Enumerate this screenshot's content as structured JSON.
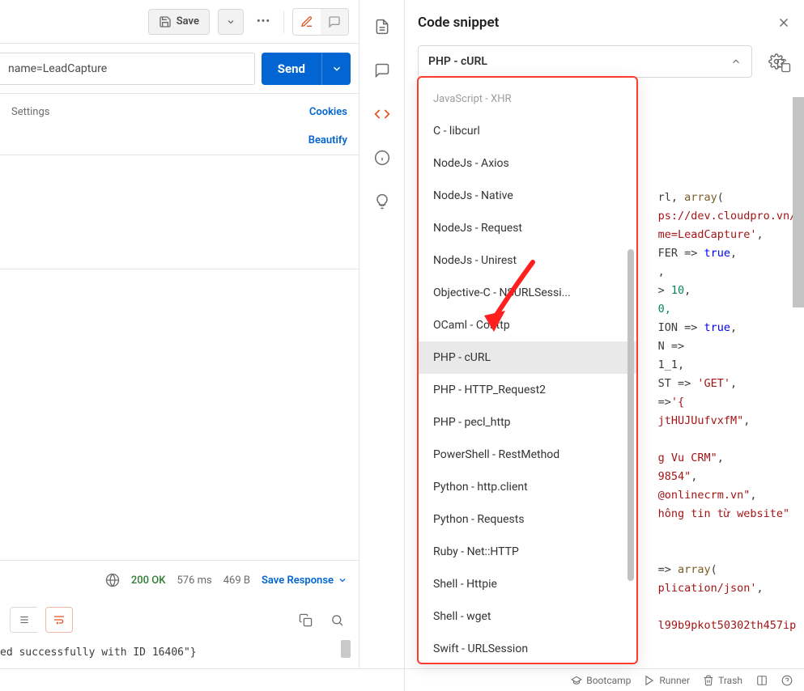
{
  "toolbar": {
    "save_label": "Save"
  },
  "url": {
    "value": "name=LeadCapture"
  },
  "send_label": "Send",
  "tabs": {
    "settings_label": "Settings",
    "cookies_label": "Cookies",
    "beautify_label": "Beautify"
  },
  "response": {
    "status": "200 OK",
    "time": "576 ms",
    "size": "469 B",
    "save_label": "Save Response",
    "body": "ed successfully with ID 16406\"}"
  },
  "snippet": {
    "title": "Code snippet",
    "selected": "PHP - cURL",
    "options": [
      "JavaScript - XHR",
      "C - libcurl",
      "NodeJs - Axios",
      "NodeJs - Native",
      "NodeJs - Request",
      "NodeJs - Unirest",
      "Objective-C - NSURLSessi...",
      "OCaml - Cohttp",
      "PHP - cURL",
      "PHP - HTTP_Request2",
      "PHP - pecl_http",
      "PowerShell - RestMethod",
      "Python - http.client",
      "Python - Requests",
      "Ruby - Net::HTTP",
      "Shell - Httpie",
      "Shell - wget",
      "Swift - URLSession"
    ]
  },
  "code": {
    "l1a": "rl, ",
    "l1b": "array",
    "l1c": "(",
    "l2": "ps://dev.cloudpro.vn/",
    "l3": "me=LeadCapture'",
    "l4a": "FER => ",
    "l4b": "true",
    "l5": ",",
    "l6a": "> ",
    "l6b": "10",
    "l7": "0,",
    "l8a": "ION => ",
    "l8b": "true",
    "l9": "N =>",
    "l10": "1_1,",
    "l11a": "ST => ",
    "l11b": "'GET'",
    "l12a": "=>",
    "l12b": "'{",
    "l13": "jtHUJUufvxfM\"",
    "l14": "",
    "l15": "g Vu CRM\"",
    "l16": "9854\"",
    "l17": "@onlinecrm.vn\"",
    "l18": "hông tin từ website\"",
    "l19": "",
    "l20a": "=> ",
    "l20b": "array",
    "l20c": "(",
    "l21": "plication/json'",
    "l22": "",
    "l23": "l99b9pkot50302th457ip"
  },
  "statusbar": {
    "bootcamp": "Bootcamp",
    "runner": "Runner",
    "trash": "Trash"
  }
}
